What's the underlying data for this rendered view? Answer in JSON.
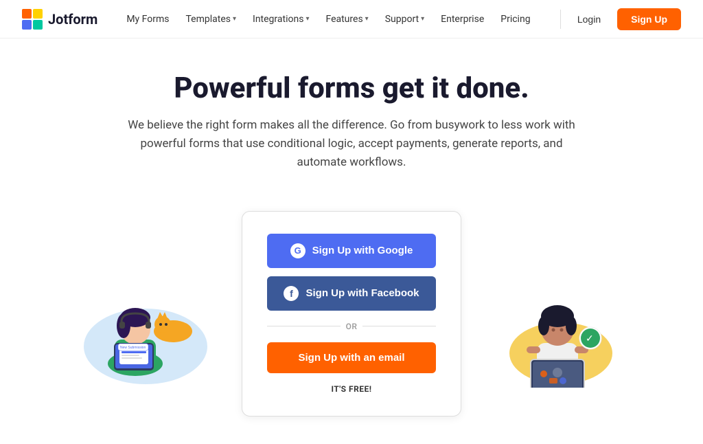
{
  "brand": {
    "name": "Jotform",
    "logo_alt": "Jotform Logo"
  },
  "navbar": {
    "links": [
      {
        "label": "My Forms",
        "has_dropdown": false
      },
      {
        "label": "Templates",
        "has_dropdown": true
      },
      {
        "label": "Integrations",
        "has_dropdown": true
      },
      {
        "label": "Features",
        "has_dropdown": true
      },
      {
        "label": "Support",
        "has_dropdown": true
      },
      {
        "label": "Enterprise",
        "has_dropdown": false
      },
      {
        "label": "Pricing",
        "has_dropdown": false
      }
    ],
    "login_label": "Login",
    "signup_label": "Sign Up"
  },
  "hero": {
    "title": "Powerful forms get it done.",
    "subtitle": "We believe the right form makes all the difference. Go from busywork to less work with powerful forms that use conditional logic, accept payments, generate reports, and automate workflows."
  },
  "signup_card": {
    "google_btn": "Sign Up with Google",
    "facebook_btn": "Sign Up with Facebook",
    "or_text": "OR",
    "email_btn": "Sign Up with an email",
    "free_label": "IT'S FREE!"
  },
  "colors": {
    "orange": "#ff6100",
    "google_blue": "#4e6cf2",
    "facebook_blue": "#3b5998",
    "navy": "#1a1a2e"
  }
}
